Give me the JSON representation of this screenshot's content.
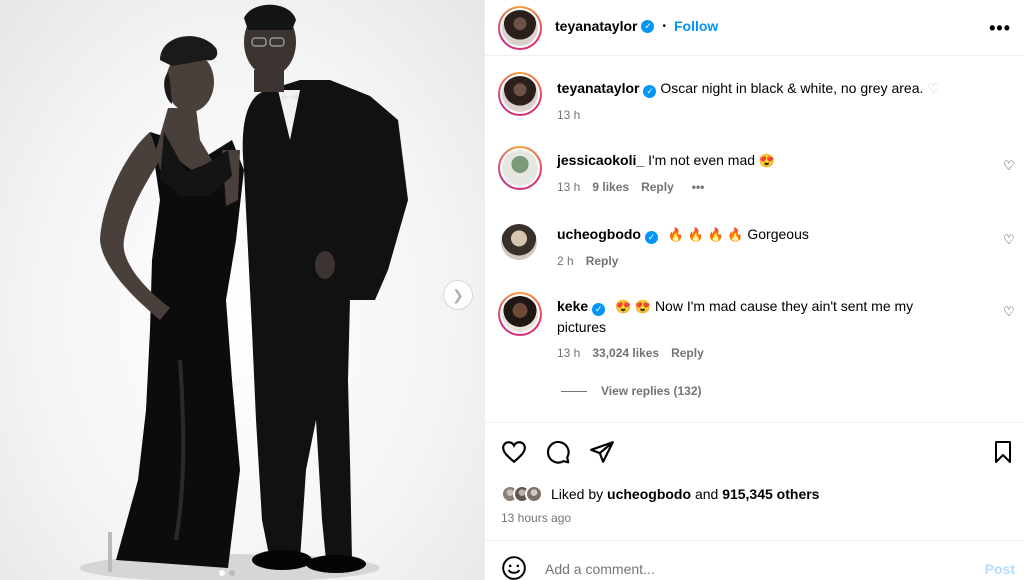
{
  "post": {
    "author": "teyanataylor",
    "follow_label": "Follow",
    "separator": "•",
    "more_label": "•••",
    "caption": "Oscar night in black & white, no grey area.",
    "caption_time": "13 h"
  },
  "comments": [
    {
      "user": "jessicaokoli_",
      "verified": false,
      "text": "I'm not even mad",
      "emoji": "😍",
      "time": "13 h",
      "likes": "9 likes",
      "reply": "Reply",
      "more": "•••"
    },
    {
      "user": "ucheogbodo",
      "verified": true,
      "emoji": "🔥 🔥 🔥 🔥",
      "text": "Gorgeous",
      "time": "2 h",
      "reply": "Reply"
    },
    {
      "user": "keke",
      "verified": true,
      "emoji": "😍 😍",
      "text": "Now I'm mad cause they ain't sent me my pictures",
      "time": "13 h",
      "likes": "33,024 likes",
      "reply": "Reply"
    }
  ],
  "view_replies": "View replies (132)",
  "likes": {
    "prefix": "Liked by",
    "user": "ucheogbodo",
    "middle": "and",
    "count": "915,345 others"
  },
  "time_ago": "13 hours ago",
  "add_comment": {
    "placeholder": "Add a comment...",
    "post_label": "Post"
  },
  "colors": {
    "accent": "#0095f6",
    "muted": "#737373",
    "divider": "#efefef"
  },
  "icons": [
    "verified-badge-icon",
    "heart-icon",
    "comment-icon",
    "share-icon",
    "bookmark-icon",
    "emoji-icon",
    "chevron-right-icon",
    "more-icon"
  ]
}
